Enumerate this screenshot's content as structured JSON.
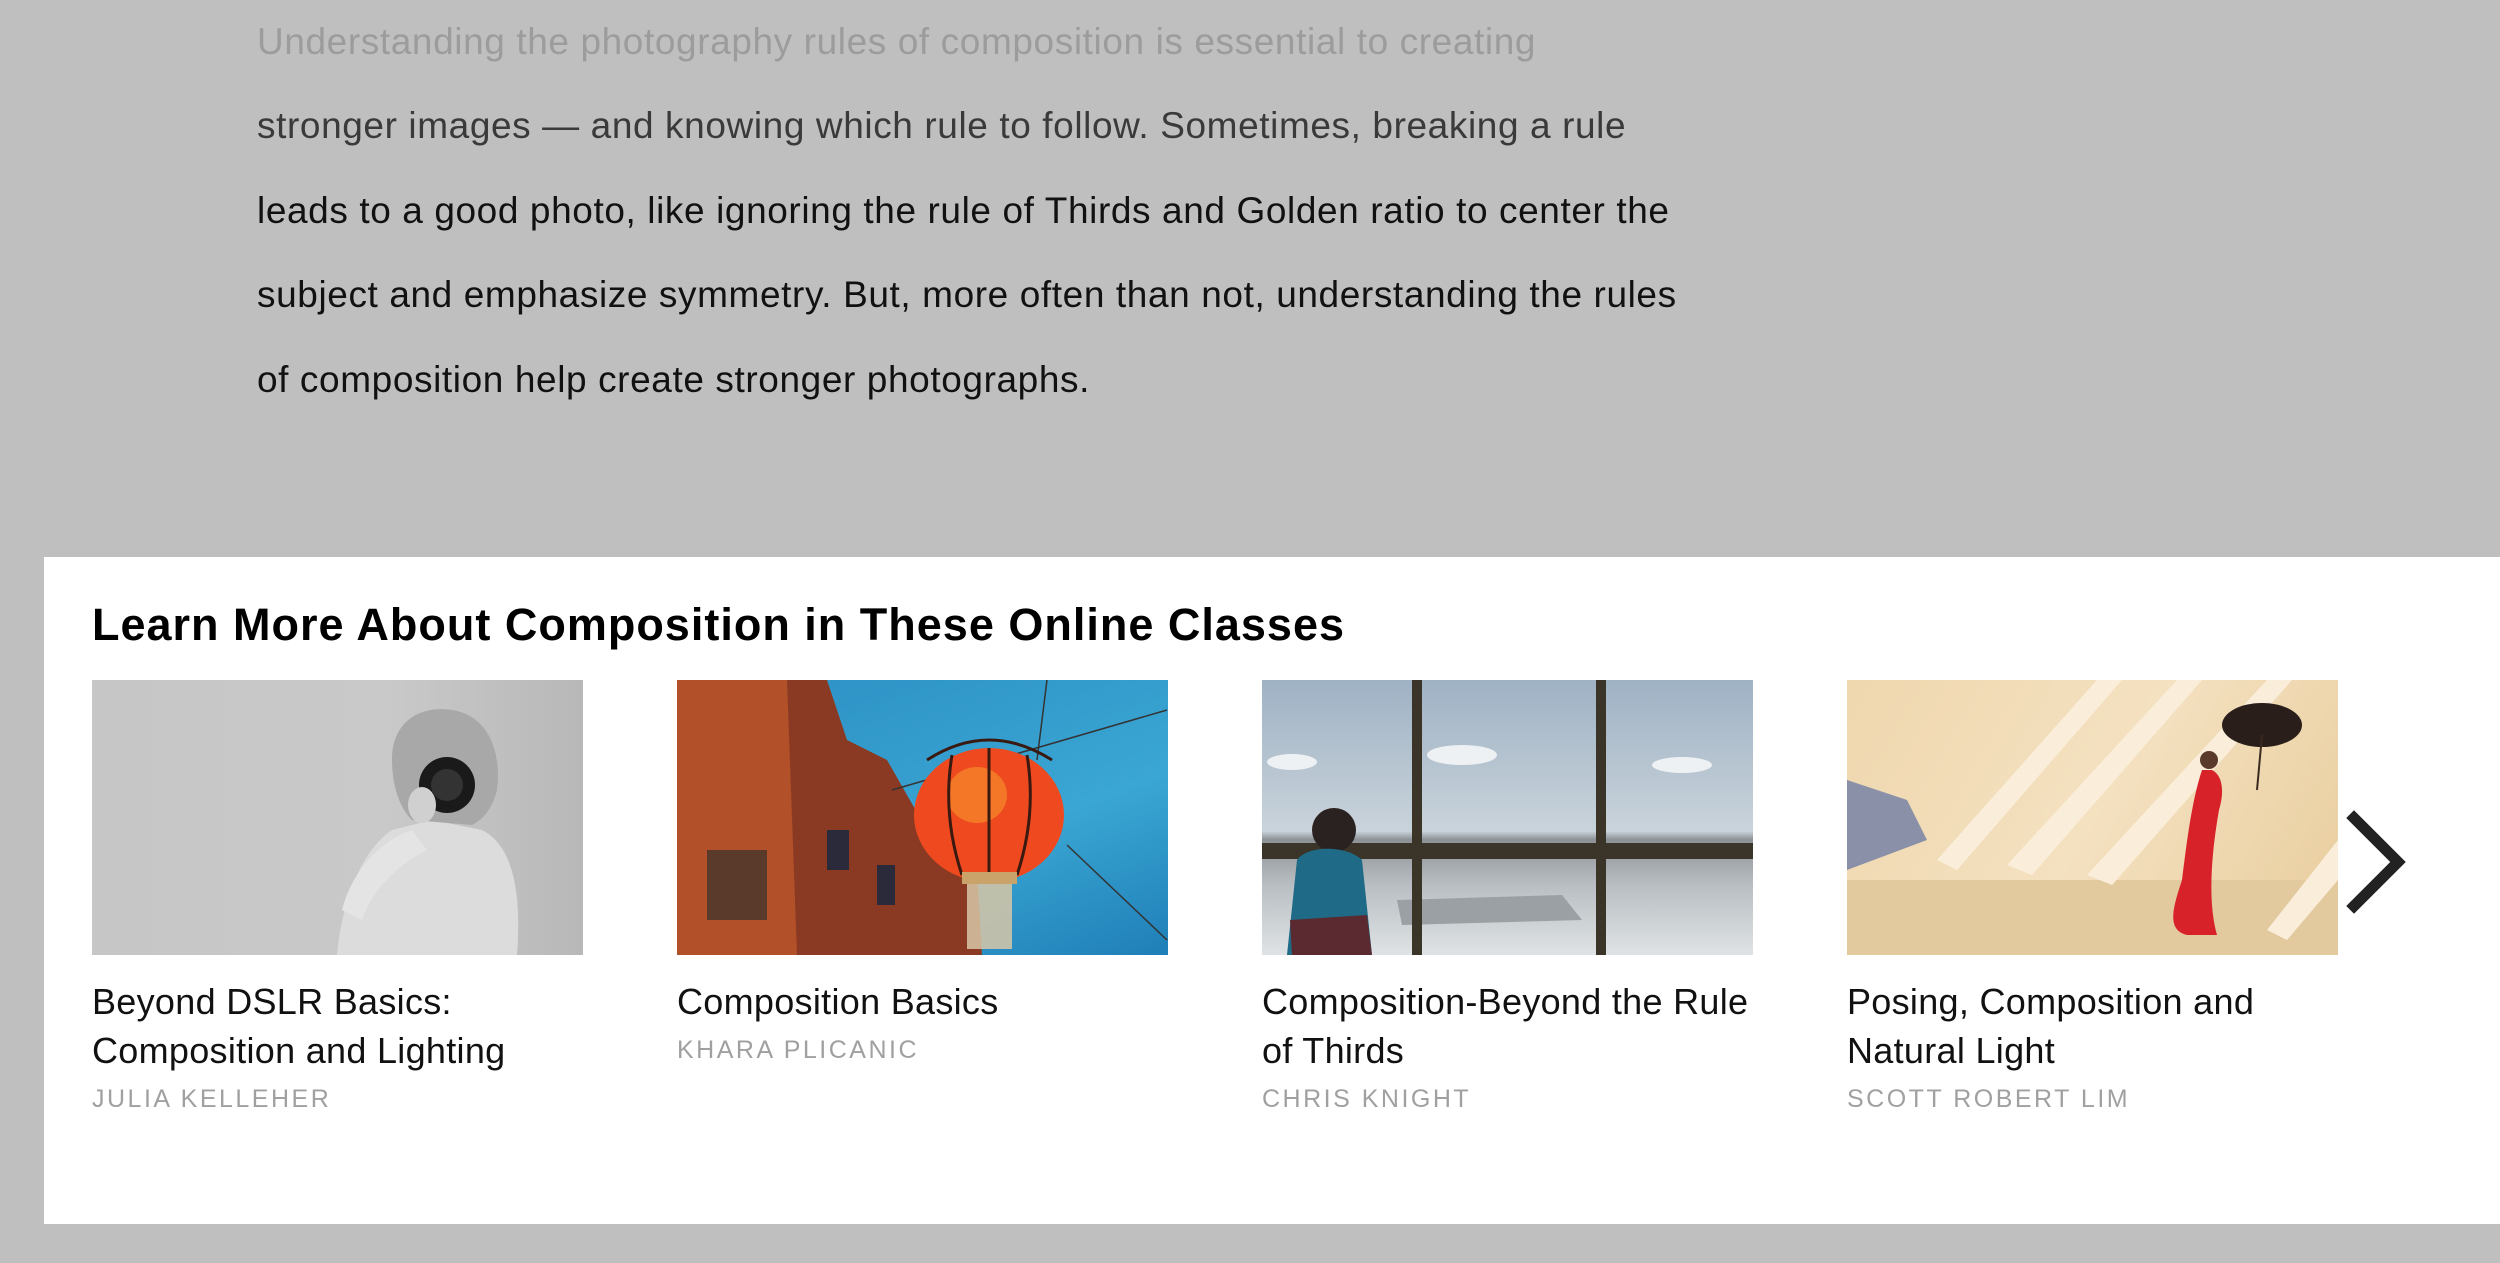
{
  "article": {
    "lines": [
      "Understanding the photography rules of composition is essential to creating",
      "stronger images — and knowing which rule to follow. Sometimes, breaking a rule",
      "leads to a good photo, like ignoring the rule of Thirds and Golden ratio to center the",
      "subject and emphasize symmetry. But, more often than not, understanding the rules",
      "of composition help create stronger photographs."
    ]
  },
  "related": {
    "title": "Learn More About Composition in These Online Classes",
    "classes": [
      {
        "title": "Beyond DSLR Basics: Composition and Lighting",
        "author": "JULIA KELLEHER",
        "image": "woman-with-camera-photo"
      },
      {
        "title": "Composition Basics",
        "author": "KHARA PLICANIC",
        "image": "red-lantern-photo"
      },
      {
        "title": "Composition-Beyond the Rule of Thirds",
        "author": "CHRIS KNIGHT",
        "image": "boy-at-window-photo"
      },
      {
        "title": "Posing, Composition and Natural Light",
        "author": "SCOTT ROBERT LIM",
        "image": "woman-red-dress-photo"
      }
    ],
    "next_icon": "chevron-right-icon"
  },
  "colors": {
    "page_background": "#bfbfbf",
    "panel_background": "#ffffff",
    "author_text": "#a0a0a0"
  }
}
